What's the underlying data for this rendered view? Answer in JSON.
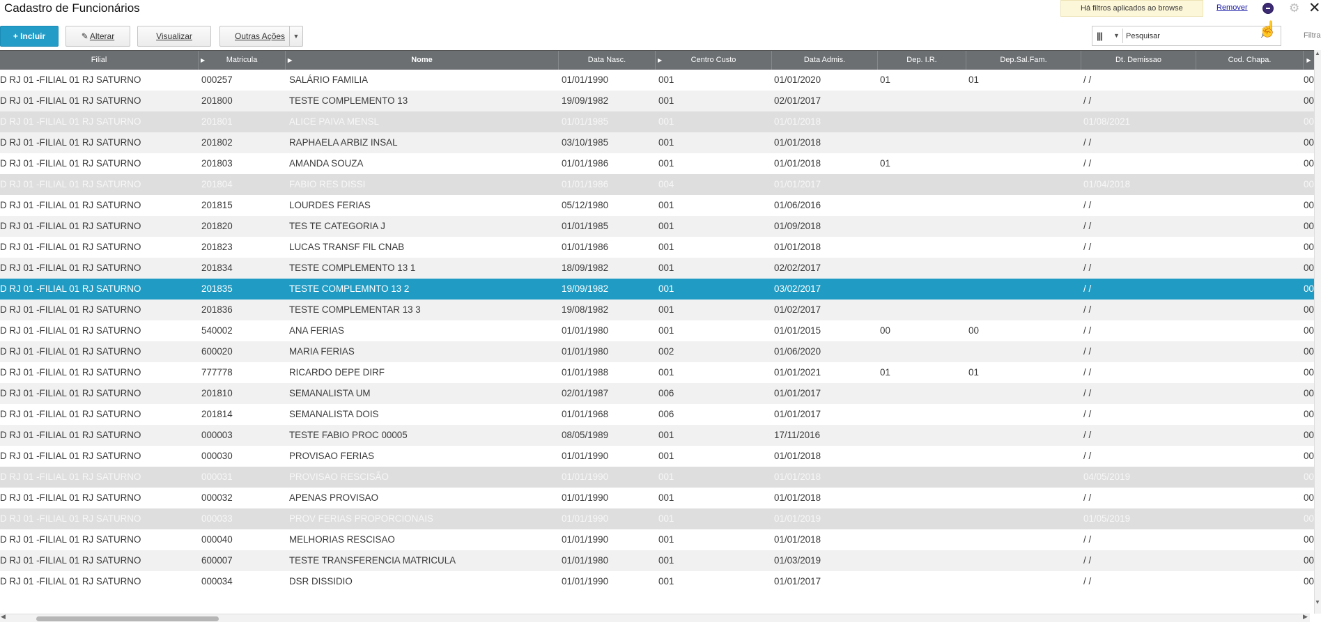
{
  "title": "Cadastro de Funcionários",
  "filter_notice": {
    "text": "Há filtros aplicados ao browse",
    "remove_label": "Remover"
  },
  "toolbar": {
    "incluir_label": "+ Incluir",
    "alterar_label": "Alterar",
    "visualizar_label": "Visualizar",
    "outras_label": "Outras Ações"
  },
  "search": {
    "value": "Pesquisar",
    "filtrar_label": "Filtrar"
  },
  "columns": [
    "Filial",
    "Matricula",
    "Nome",
    "Data Nasc.",
    "Centro Custo",
    "Data Admis.",
    "Dep. I.R.",
    "Dep.Sal.Fam.",
    "Dt. Demissao",
    "Cod. Chapa."
  ],
  "rows": [
    {
      "filial": "D RJ 01 -FILIAL 01 RJ SATURNO",
      "mat": "000257",
      "nome": "SALÁRIO FAMILIA",
      "nasc": "01/01/1990",
      "cc": "001",
      "adm": "01/01/2020",
      "depir": "01",
      "depsal": "01",
      "dem": " /  /",
      "chapa": "00",
      "state": "normal"
    },
    {
      "filial": "D RJ 01 -FILIAL 01 RJ SATURNO",
      "mat": "201800",
      "nome": "TESTE COMPLEMENTO 13",
      "nasc": "19/09/1982",
      "cc": "001",
      "adm": "02/01/2017",
      "depir": "",
      "depsal": "",
      "dem": " /  /",
      "chapa": "00",
      "state": "normal"
    },
    {
      "filial": "D RJ 01 -FILIAL 01 RJ SATURNO",
      "mat": "201801",
      "nome": "ALICE PAIVA MENSL",
      "nasc": "01/01/1985",
      "cc": "001",
      "adm": "01/01/2018",
      "depir": "",
      "depsal": "",
      "dem": "01/08/2021",
      "chapa": "00",
      "state": "disabled"
    },
    {
      "filial": "D RJ 01 -FILIAL 01 RJ SATURNO",
      "mat": "201802",
      "nome": "RAPHAELA ARBIZ INSAL",
      "nasc": "03/10/1985",
      "cc": "001",
      "adm": "01/01/2018",
      "depir": "",
      "depsal": "",
      "dem": " /  /",
      "chapa": "00",
      "state": "normal"
    },
    {
      "filial": "D RJ 01 -FILIAL 01 RJ SATURNO",
      "mat": "201803",
      "nome": "AMANDA SOUZA",
      "nasc": "01/01/1986",
      "cc": "001",
      "adm": "01/01/2018",
      "depir": "01",
      "depsal": "",
      "dem": " /  /",
      "chapa": "00",
      "state": "normal"
    },
    {
      "filial": "D RJ 01 -FILIAL 01 RJ SATURNO",
      "mat": "201804",
      "nome": "FABIO RES DISSI",
      "nasc": "01/01/1986",
      "cc": "004",
      "adm": "01/01/2017",
      "depir": "",
      "depsal": "",
      "dem": "01/04/2018",
      "chapa": "00",
      "state": "disabled"
    },
    {
      "filial": "D RJ 01 -FILIAL 01 RJ SATURNO",
      "mat": "201815",
      "nome": "LOURDES FERIAS",
      "nasc": "05/12/1980",
      "cc": "001",
      "adm": "01/06/2016",
      "depir": "",
      "depsal": "",
      "dem": " /  /",
      "chapa": "00",
      "state": "normal"
    },
    {
      "filial": "D RJ 01 -FILIAL 01 RJ SATURNO",
      "mat": "201820",
      "nome": "TES TE CATEGORIA J",
      "nasc": "01/01/1985",
      "cc": "001",
      "adm": "01/09/2018",
      "depir": "",
      "depsal": "",
      "dem": " /  /",
      "chapa": "00",
      "state": "normal"
    },
    {
      "filial": "D RJ 01 -FILIAL 01 RJ SATURNO",
      "mat": "201823",
      "nome": "LUCAS TRANSF FIL CNAB",
      "nasc": "01/01/1986",
      "cc": "001",
      "adm": "01/01/2018",
      "depir": "",
      "depsal": "",
      "dem": " /  /",
      "chapa": "00",
      "state": "normal"
    },
    {
      "filial": "D RJ 01 -FILIAL 01 RJ SATURNO",
      "mat": "201834",
      "nome": "TESTE COMPLEMENTO 13 1",
      "nasc": "18/09/1982",
      "cc": "001",
      "adm": "02/02/2017",
      "depir": "",
      "depsal": "",
      "dem": " /  /",
      "chapa": "00",
      "state": "normal"
    },
    {
      "filial": "D RJ 01 -FILIAL 01 RJ SATURNO",
      "mat": "201835",
      "nome": "TESTE COMPLEMNTO 13 2",
      "nasc": "19/09/1982",
      "cc": "001",
      "adm": "03/02/2017",
      "depir": "",
      "depsal": "",
      "dem": " /  /",
      "chapa": "00",
      "state": "selected"
    },
    {
      "filial": "D RJ 01 -FILIAL 01 RJ SATURNO",
      "mat": "201836",
      "nome": "TESTE COMPLEMENTAR 13 3",
      "nasc": "19/08/1982",
      "cc": "001",
      "adm": "01/02/2017",
      "depir": "",
      "depsal": "",
      "dem": " /  /",
      "chapa": "00",
      "state": "normal"
    },
    {
      "filial": "D RJ 01 -FILIAL 01 RJ SATURNO",
      "mat": "540002",
      "nome": "ANA FERIAS",
      "nasc": "01/01/1980",
      "cc": "001",
      "adm": "01/01/2015",
      "depir": "00",
      "depsal": "00",
      "dem": " /  /",
      "chapa": "00",
      "state": "normal"
    },
    {
      "filial": "D RJ 01 -FILIAL 01 RJ SATURNO",
      "mat": "600020",
      "nome": "MARIA FERIAS",
      "nasc": "01/01/1980",
      "cc": "002",
      "adm": "01/06/2020",
      "depir": "",
      "depsal": "",
      "dem": " /  /",
      "chapa": "00",
      "state": "normal"
    },
    {
      "filial": "D RJ 01 -FILIAL 01 RJ SATURNO",
      "mat": "777778",
      "nome": "RICARDO DEPE DIRF",
      "nasc": "01/01/1988",
      "cc": "001",
      "adm": "01/01/2021",
      "depir": "01",
      "depsal": "01",
      "dem": " /  /",
      "chapa": "00",
      "state": "normal"
    },
    {
      "filial": "D RJ 01 -FILIAL 01 RJ SATURNO",
      "mat": "201810",
      "nome": "SEMANALISTA UM",
      "nasc": "02/01/1987",
      "cc": "006",
      "adm": "01/01/2017",
      "depir": "",
      "depsal": "",
      "dem": " /  /",
      "chapa": "00",
      "state": "normal"
    },
    {
      "filial": "D RJ 01 -FILIAL 01 RJ SATURNO",
      "mat": "201814",
      "nome": "SEMANALISTA DOIS",
      "nasc": "01/01/1968",
      "cc": "006",
      "adm": "01/01/2017",
      "depir": "",
      "depsal": "",
      "dem": " /  /",
      "chapa": "00",
      "state": "normal"
    },
    {
      "filial": "D RJ 01 -FILIAL 01 RJ SATURNO",
      "mat": "000003",
      "nome": "TESTE FABIO PROC 00005",
      "nasc": "08/05/1989",
      "cc": "001",
      "adm": "17/11/2016",
      "depir": "",
      "depsal": "",
      "dem": " /  /",
      "chapa": "00",
      "state": "normal"
    },
    {
      "filial": "D RJ 01 -FILIAL 01 RJ SATURNO",
      "mat": "000030",
      "nome": "PROVISAO FERIAS",
      "nasc": "01/01/1990",
      "cc": "001",
      "adm": "01/01/2018",
      "depir": "",
      "depsal": "",
      "dem": " /  /",
      "chapa": "00",
      "state": "normal"
    },
    {
      "filial": "D RJ 01 -FILIAL 01 RJ SATURNO",
      "mat": "000031",
      "nome": "PROVISAO RESCISÃO",
      "nasc": "01/01/1990",
      "cc": "001",
      "adm": "01/01/2018",
      "depir": "",
      "depsal": "",
      "dem": "04/05/2019",
      "chapa": "00",
      "state": "disabled"
    },
    {
      "filial": "D RJ 01 -FILIAL 01 RJ SATURNO",
      "mat": "000032",
      "nome": "APENAS PROVISAO",
      "nasc": "01/01/1990",
      "cc": "001",
      "adm": "01/01/2018",
      "depir": "",
      "depsal": "",
      "dem": " /  /",
      "chapa": "00",
      "state": "normal"
    },
    {
      "filial": "D RJ 01 -FILIAL 01 RJ SATURNO",
      "mat": "000033",
      "nome": "PROV FERIAS PROPORCIONAIS",
      "nasc": "01/01/1990",
      "cc": "001",
      "adm": "01/01/2019",
      "depir": "",
      "depsal": "",
      "dem": "01/05/2019",
      "chapa": "00",
      "state": "disabled"
    },
    {
      "filial": "D RJ 01 -FILIAL 01 RJ SATURNO",
      "mat": "000040",
      "nome": "MELHORIAS RESCISAO",
      "nasc": "01/01/1990",
      "cc": "001",
      "adm": "01/01/2018",
      "depir": "",
      "depsal": "",
      "dem": " /  /",
      "chapa": "00",
      "state": "normal"
    },
    {
      "filial": "D RJ 01 -FILIAL 01 RJ SATURNO",
      "mat": "600007",
      "nome": "TESTE TRANSFERENCIA MATRICULA",
      "nasc": "01/01/1980",
      "cc": "001",
      "adm": "01/03/2019",
      "depir": "",
      "depsal": "",
      "dem": " /  /",
      "chapa": "00",
      "state": "normal"
    },
    {
      "filial": "D RJ 01 -FILIAL 01 RJ SATURNO",
      "mat": "000034",
      "nome": "DSR DISSIDIO",
      "nasc": "01/01/1990",
      "cc": "001",
      "adm": "01/01/2017",
      "depir": "",
      "depsal": "",
      "dem": " /  /",
      "chapa": "00",
      "state": "normal"
    }
  ],
  "colors": {
    "accent": "#239cc8",
    "selected_row": "#1f9bc4",
    "disabled_row": "#dedede",
    "header_bg": "#6b6f72"
  },
  "icons": [
    "pencil-icon",
    "caret-down-icon",
    "columns-icon",
    "search-icon",
    "gear-icon",
    "close-icon",
    "hand-cursor-icon"
  ]
}
